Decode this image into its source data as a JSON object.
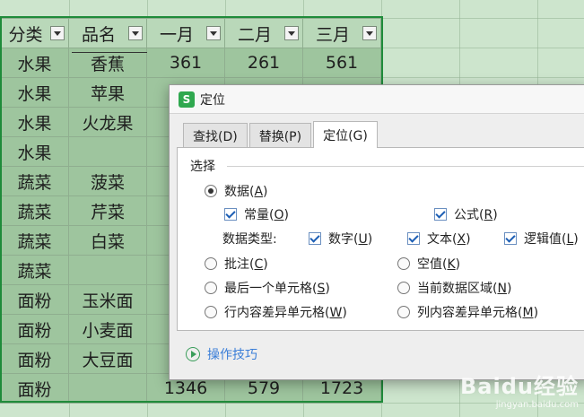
{
  "sheet": {
    "headers": [
      "分类",
      "品名",
      "一月",
      "二月",
      "三月"
    ],
    "rows": [
      [
        "水果",
        "香蕉",
        "361",
        "261",
        "561"
      ],
      [
        "水果",
        "苹果",
        "",
        "",
        ""
      ],
      [
        "水果",
        "火龙果",
        "",
        "",
        ""
      ],
      [
        "水果",
        "",
        "",
        "",
        ""
      ],
      [
        "蔬菜",
        "菠菜",
        "",
        "",
        ""
      ],
      [
        "蔬菜",
        "芹菜",
        "",
        "",
        ""
      ],
      [
        "蔬菜",
        "白菜",
        "",
        "",
        ""
      ],
      [
        "蔬菜",
        "",
        "",
        "",
        ""
      ],
      [
        "面粉",
        "玉米面",
        "",
        "",
        ""
      ],
      [
        "面粉",
        "小麦面",
        "",
        "",
        ""
      ],
      [
        "面粉",
        "大豆面",
        "",
        "",
        ""
      ],
      [
        "面粉",
        "",
        "1346",
        "579",
        "1723"
      ]
    ]
  },
  "dialog": {
    "title": "定位",
    "app_icon_letter": "S",
    "tabs": [
      "查找(D)",
      "替换(P)",
      "定位(G)"
    ],
    "active_tab": "定位(G)",
    "group_label": "选择",
    "options": {
      "data": {
        "label": "数据",
        "key": "A",
        "checked": true
      },
      "constant": {
        "label": "常量",
        "key": "O",
        "checked": true
      },
      "formula": {
        "label": "公式",
        "key": "R",
        "checked": true
      },
      "data_type_label": "数据类型:",
      "number": {
        "label": "数字",
        "key": "U",
        "checked": true
      },
      "text": {
        "label": "文本",
        "key": "X",
        "checked": true
      },
      "logical": {
        "label": "逻辑值",
        "key": "L",
        "checked": true
      },
      "comment": {
        "label": "批注",
        "key": "C",
        "checked": false
      },
      "blank": {
        "label": "空值",
        "key": "K",
        "checked": false
      },
      "last_cell": {
        "label": "最后一个单元格",
        "key": "S",
        "checked": false
      },
      "current_region": {
        "label": "当前数据区域",
        "key": "N",
        "checked": false
      },
      "row_diff": {
        "label": "行内容差异单元格",
        "key": "W",
        "checked": false
      },
      "col_diff": {
        "label": "列内容差异单元格",
        "key": "M",
        "checked": false
      }
    },
    "tips_label": "操作技巧"
  },
  "watermark": {
    "main": "Baidu经验",
    "sub": "jingyan.baidu.com"
  },
  "colors": {
    "selection": "#1f8b3a",
    "cell_bg": "#9ec59e",
    "link": "#3a7ed8"
  }
}
